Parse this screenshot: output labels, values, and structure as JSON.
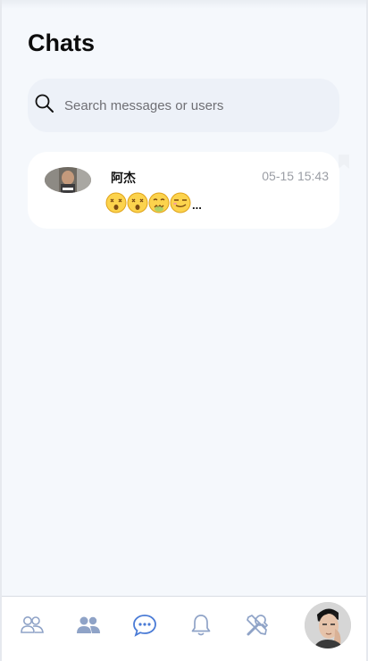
{
  "header": {
    "title": "Chats"
  },
  "search": {
    "placeholder": "Search messages or users",
    "icon": "search-icon"
  },
  "chats": [
    {
      "name": "阿杰",
      "time": "05-15 15:43",
      "preview_ellipsis": "...",
      "preview_emojis": [
        "dizzy-face-emoji",
        "dizzy-face-emoji",
        "confounded-face-emoji",
        "smirk-face-emoji"
      ],
      "pinned_icon": "bookmark-icon"
    }
  ],
  "bottom_nav": {
    "items": [
      {
        "icon": "contacts-outline-icon",
        "active": false
      },
      {
        "icon": "users-icon",
        "active": false
      },
      {
        "icon": "chat-bubble-icon",
        "active": true
      },
      {
        "icon": "bell-icon",
        "active": false
      },
      {
        "icon": "tools-icon",
        "active": false
      },
      {
        "icon": "profile-avatar",
        "active": false
      }
    ]
  },
  "colors": {
    "background": "#f5f8fc",
    "card": "#ffffff",
    "search_bg": "#edf1f8",
    "nav_inactive": "#8fa3c7",
    "nav_active": "#4a7bd6",
    "time_text": "#9b9ea5"
  }
}
